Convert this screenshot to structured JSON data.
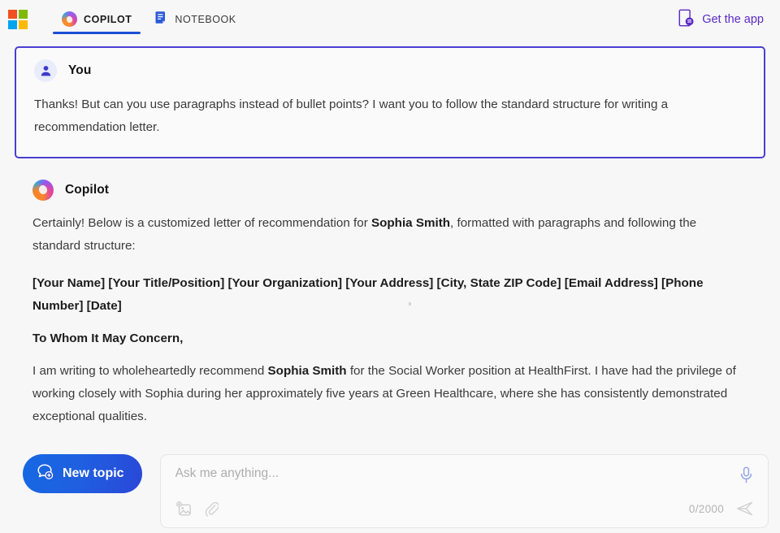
{
  "header": {
    "logo": {
      "name": "microsoft-logo",
      "colors": [
        "#f25022",
        "#7fba00",
        "#00a4ef",
        "#ffb900"
      ]
    },
    "tabs": [
      {
        "id": "copilot",
        "label": "COPILOT",
        "icon": "copilot-icon",
        "active": true
      },
      {
        "id": "notebook",
        "label": "NOTEBOOK",
        "icon": "notebook-icon",
        "active": false
      }
    ],
    "get_app": {
      "label": "Get the app",
      "icon": "phone-chat-icon",
      "color": "#5b2bc4"
    },
    "active_tab_underline_color": "#1a4fd6"
  },
  "conversation": {
    "user_message": {
      "author": "You",
      "avatar_icon": "person-icon",
      "highlight_border_color": "#4b3fd1",
      "text": "Thanks! But can you use paragraphs instead of bullet points? I want you to follow the standard structure for writing a recommendation letter."
    },
    "assistant_message": {
      "author": "Copilot",
      "avatar_icon": "copilot-icon",
      "intro_before": "Certainly! Below is a customized letter of recommendation for ",
      "intro_bold": "Sophia Smith",
      "intro_after": ", formatted with paragraphs and following the standard structure:",
      "letter_header": "[Your Name] [Your Title/Position] [Your Organization] [Your Address] [City, State ZIP Code] [Email Address] [Phone Number] [Date]",
      "salutation": "To Whom It May Concern,",
      "paragraph_1_before": "I am writing to wholeheartedly recommend ",
      "paragraph_1_bold": "Sophia Smith",
      "paragraph_1_after": " for the Social Worker position at HealthFirst. I have had the privilege of working closely with Sophia during her approximately five years at Green Healthcare, where she has consistently demonstrated exceptional qualities."
    }
  },
  "composer": {
    "new_topic": {
      "label": "New topic",
      "icon": "chat-plus-icon"
    },
    "input": {
      "value": "",
      "placeholder": "Ask me anything..."
    },
    "mic_icon": "microphone-icon",
    "image_icon": "add-image-icon",
    "attach_icon": "paperclip-icon",
    "counter": "0/2000",
    "send_icon": "send-icon"
  }
}
